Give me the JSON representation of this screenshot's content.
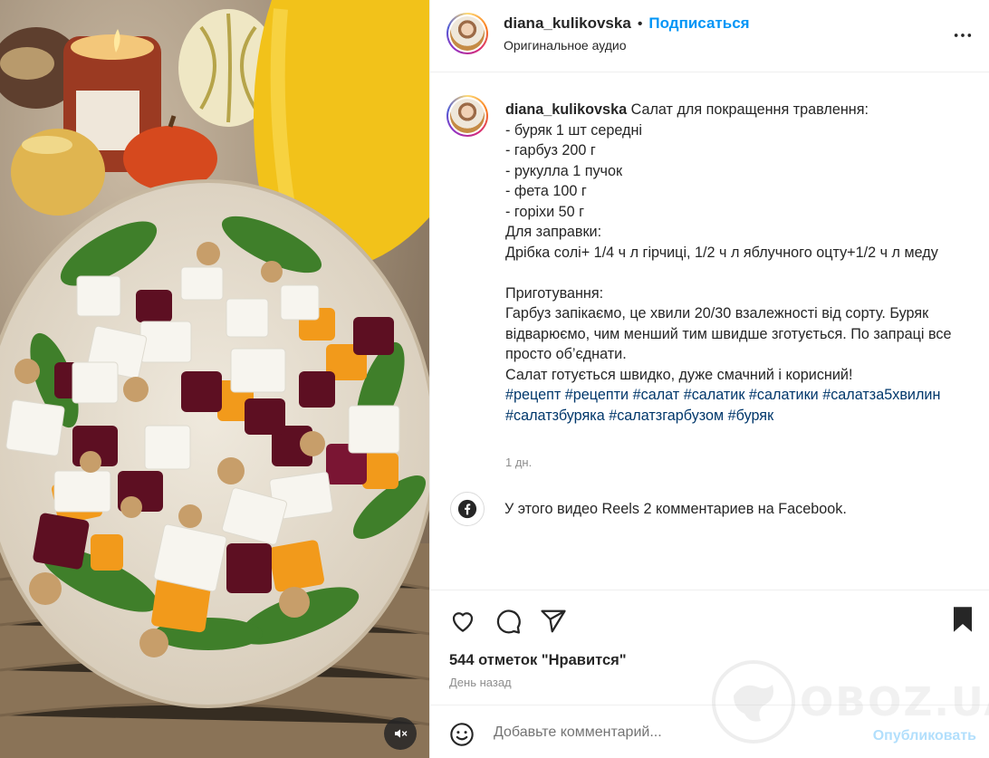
{
  "header": {
    "username": "diana_kulikovska",
    "separator": "•",
    "follow_label": "Подписаться",
    "audio_label": "Оригинальное аудио",
    "more_icon": "more-horizontal-icon"
  },
  "caption": {
    "username": "diana_kulikovska",
    "text": " Салат для покращення травлення:\n- буряк 1 шт середні\n- гарбуз 200 г\n- рукулла 1 пучок\n- фета 100 г\n- горіхи 50 г\nДля заправки:\nДрібка солі+ 1/4 ч л гірчиці, 1/2 ч л яблучного оцту+1/2 ч л меду\n\nПриготування:\nГарбуз запікаємо, це хвили 20/30 взалежності від сорту. Буряк відварюємо, чим менший тим швидше зготується. По запраці все просто об’єднати.\nСалат готується швидко, дуже смачний і корисний!\n",
    "tags": "#рецепт #рецепти #салат #салатик #салатики #салатза5хвилин #салатзбуряка #салатзгарбузом #буряк",
    "time": "1 дн."
  },
  "facebook": {
    "icon": "facebook-icon",
    "text": "У этого видео Reels 2 комментариев на Facebook."
  },
  "actions": {
    "like_icon": "heart-icon",
    "comment_icon": "comment-icon",
    "share_icon": "send-icon",
    "save_icon": "bookmark-icon"
  },
  "likes": "544 отметок \"Нравится\"",
  "posted_ago": "День назад",
  "comment_box": {
    "emoji_icon": "emoji-icon",
    "placeholder": "Добавьте комментарий...",
    "publish_label": "Опубликовать"
  },
  "media": {
    "mute_icon": "speaker-muted-icon"
  },
  "watermark": {
    "text": "OBOZ.UA",
    "logo": "globe-icon"
  },
  "colors": {
    "link_blue": "#0095f6",
    "hashtag": "#00376b",
    "muted": "#8e8e8e",
    "publish_disabled": "#b2dffc"
  }
}
